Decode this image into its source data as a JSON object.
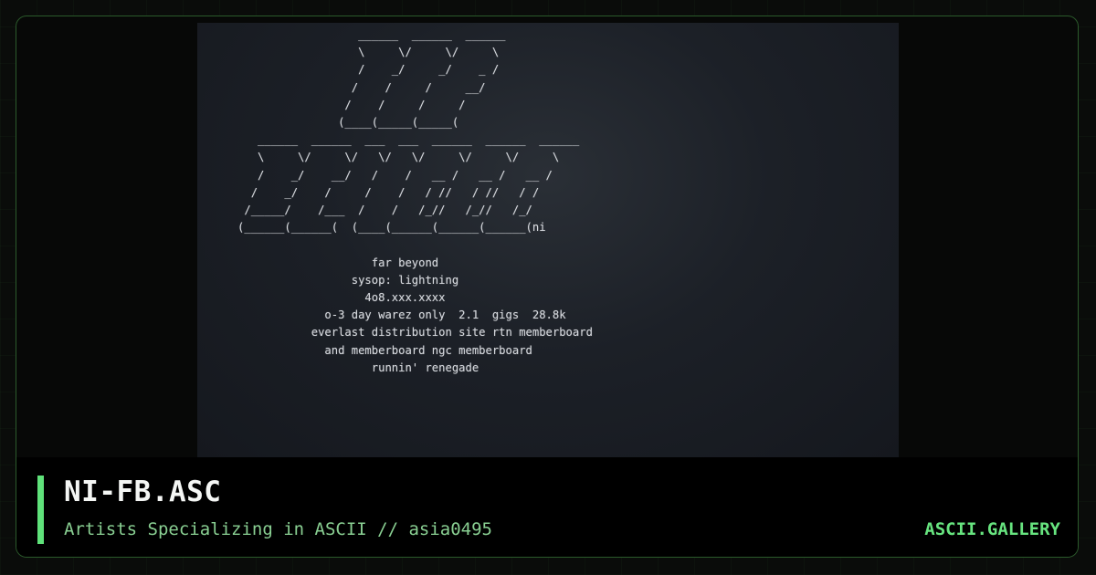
{
  "artwork": {
    "lines": [
      "                        ______  ______  ______",
      "                        \\     \\/     \\/     \\",
      "                        /    _/     _/    _ /",
      "                       /    /     /     __/",
      "                      /    /     /     /",
      "                     (____(_____(_____(",
      "         ______  ______  ___  ___  ______  ______  ______",
      "         \\     \\/     \\/   \\/   \\/     \\/     \\/     \\",
      "         /    _/    __/   /    /   __ /   __ /   __ /",
      "        /    _/    /     /    /   / //   / //   / /",
      "       /_____/    /___  /    /   /_//   /_//   /_/",
      "      (______(______(  (____(______(______(______(ni",
      "",
      "                          far beyond",
      "                       sysop: lightning",
      "                         4o8.xxx.xxxx",
      "                   o-3 day warez only  2.1  gigs  28.8k",
      "                 everlast distribution site rtn memberboard",
      "                   and memberboard ngc memberboard",
      "                          runnin' renegade"
    ]
  },
  "info": {
    "title": "NI-FB.ASC",
    "subtitle": "Artists Specializing in ASCII // asia0495",
    "brand": "ASCII.GALLERY"
  },
  "colors": {
    "accent": "#5fe27a",
    "brand": "#67e47f",
    "subtitle": "#89cf92",
    "frame_border": "#2b5a2b"
  }
}
